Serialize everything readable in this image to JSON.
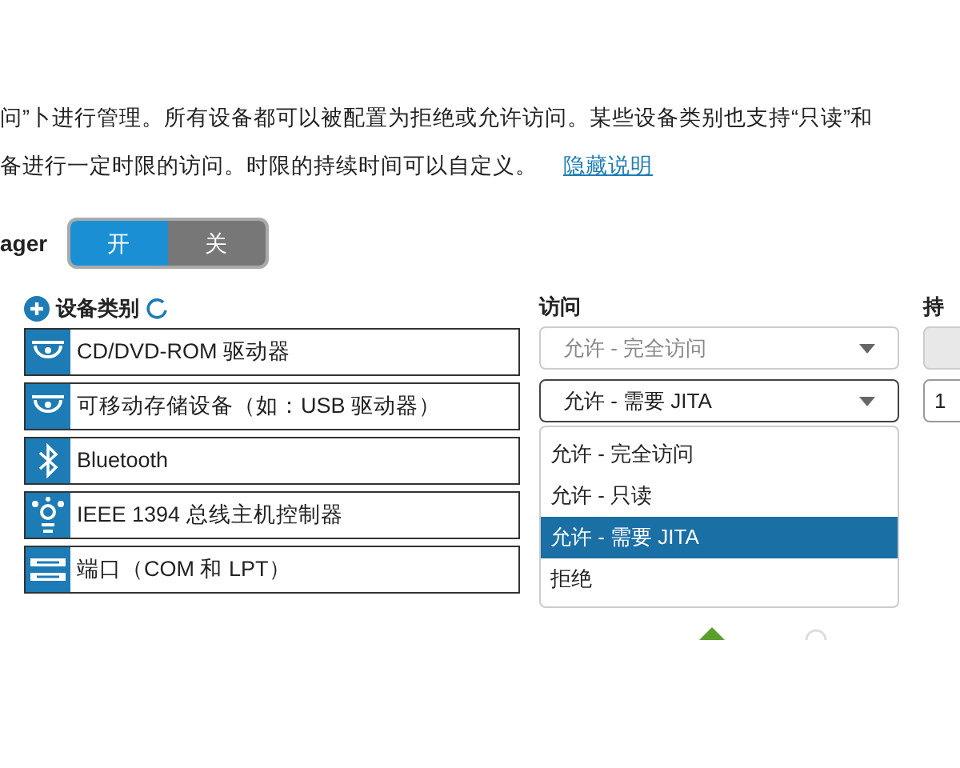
{
  "description": {
    "lines": [
      "问”卜进行管理。所有设备都可以被配置为拒绝或允许访问。某些设备类别也支持“只读”和",
      "备进行一定时限的访问。时限的持续时间可以自定义。"
    ],
    "link": "隐藏说明"
  },
  "toggle": {
    "label": "ager",
    "options": [
      {
        "label": "开",
        "selected": true
      },
      {
        "label": "关",
        "selected": false
      }
    ]
  },
  "categories": {
    "header": "设备类别",
    "items": [
      {
        "kind": "disc",
        "name": "CD/DVD-ROM 驱动器"
      },
      {
        "kind": "disc",
        "name": "可移动存储设备（如：USB 驱动器）"
      },
      {
        "kind": "bluetooth",
        "name": "Bluetooth"
      },
      {
        "kind": "firewire",
        "name": "IEEE 1394 总线主机控制器"
      },
      {
        "kind": "port",
        "name": "端口（COM 和 LPT）"
      }
    ]
  },
  "access": {
    "header": "访问",
    "selects": [
      {
        "value": "允许 - 完全访问",
        "disabled": true,
        "expanded": false
      },
      {
        "value": "允许 - 需要 JITA",
        "disabled": false,
        "expanded": true
      }
    ],
    "options": [
      {
        "label": "允许 - 完全访问",
        "selected": false
      },
      {
        "label": "允许 - 只读",
        "selected": false
      },
      {
        "label": "允许 - 需要 JITA",
        "selected": true
      },
      {
        "label": "拒绝",
        "selected": false
      }
    ]
  },
  "duration": {
    "header": "持",
    "fields": [
      {
        "disabled": true
      },
      {
        "value": "1",
        "disabled": false
      }
    ]
  }
}
